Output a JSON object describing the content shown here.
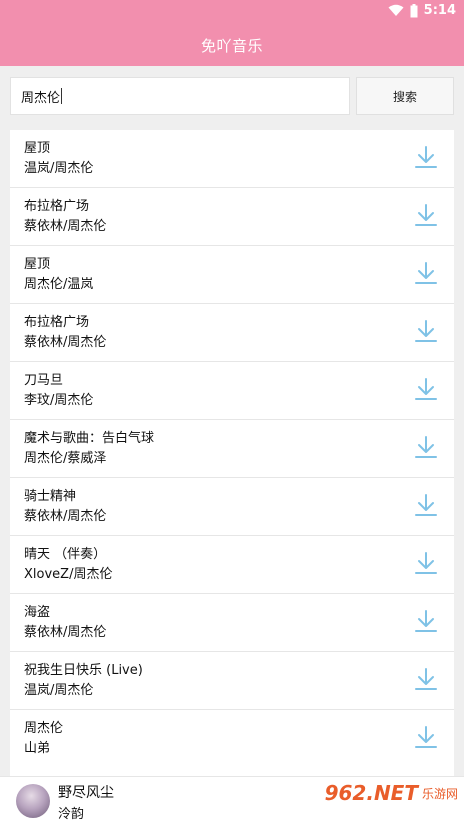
{
  "status_bar": {
    "time": "5:14",
    "icons": [
      "wifi-icon",
      "battery-icon"
    ]
  },
  "app": {
    "title": "免吖音乐"
  },
  "search": {
    "value": "周杰伦",
    "button_label": "搜索"
  },
  "songs": [
    {
      "title": "屋顶",
      "artist": "温岚/周杰伦"
    },
    {
      "title": "布拉格广场",
      "artist": "蔡依林/周杰伦"
    },
    {
      "title": "屋顶",
      "artist": "周杰伦/温岚"
    },
    {
      "title": "布拉格广场",
      "artist": "蔡依林/周杰伦"
    },
    {
      "title": "刀马旦",
      "artist": "李玟/周杰伦"
    },
    {
      "title": "魔术与歌曲：告白气球",
      "artist": "周杰伦/蔡威泽"
    },
    {
      "title": "骑士精神",
      "artist": "蔡依林/周杰伦"
    },
    {
      "title": "晴天 （伴奏）",
      "artist": "XloveZ/周杰伦"
    },
    {
      "title": "海盗",
      "artist": "蔡依林/周杰伦"
    },
    {
      "title": "祝我生日快乐 (Live)",
      "artist": "温岚/周杰伦"
    },
    {
      "title": "周杰伦",
      "artist": "山弟"
    }
  ],
  "player": {
    "title": "野尽风尘",
    "artist": "泠韵"
  },
  "watermark": {
    "main": "962.NET",
    "sub": "乐游网"
  },
  "colors": {
    "header": "#f28fae",
    "download_icon": "#7fc2e6",
    "background": "#efefef"
  }
}
